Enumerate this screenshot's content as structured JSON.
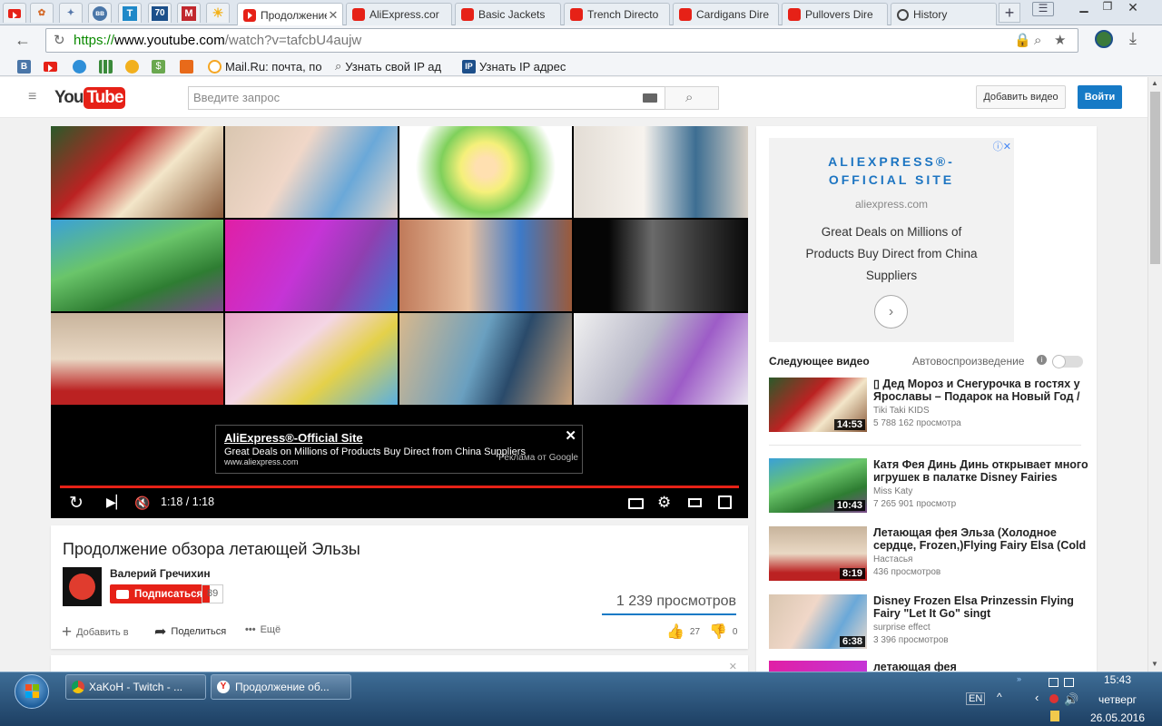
{
  "browser": {
    "tabs": [
      {
        "label": "Продолжение",
        "active": true
      },
      {
        "label": "AliExpress.cor"
      },
      {
        "label": "Basic Jackets"
      },
      {
        "label": "Trench Directo"
      },
      {
        "label": "Cardigans Dire"
      },
      {
        "label": "Pullovers Dire"
      },
      {
        "label": "History"
      }
    ],
    "pinned_labels": [
      "вв",
      "Т",
      "70",
      "М"
    ],
    "url": {
      "scheme": "https://",
      "host": "www.youtube.com",
      "path": "/watch?v=tafcbU4aujw"
    },
    "bookmarks": [
      {
        "label": "В"
      },
      {
        "label": "Mail.Ru: почта, по"
      },
      {
        "label": "Узнать свой IP ад"
      },
      {
        "label": "Узнать IP адрес"
      }
    ]
  },
  "youtube": {
    "logo": "You",
    "logo_tube": "Tube",
    "search_placeholder": "Введите запрос",
    "upload_label": "Добавить видео",
    "login_label": "Войти"
  },
  "player": {
    "ad": {
      "title": "AliExpress®-Official Site",
      "desc": "Great Deals on Millions of Products Buy Direct from China Suppliers",
      "url": "www.aliexpress.com",
      "by": "Реклама от Google"
    },
    "time": "1:18 / 1:18",
    "progress_fraction": 1.0
  },
  "video": {
    "title": "Продолжение обзора летающей Эльзы",
    "channel": "Валерий Гречихин",
    "subscribe_label": "Подписаться",
    "subscriber_count": "89",
    "views": "1 239 просмотров",
    "add_label": "Добавить в",
    "share_label": "Поделиться",
    "more_label": "Ещё",
    "likes": "27",
    "dislikes": "0"
  },
  "sidebar_ad": {
    "title_line1": "ALIEXPRESS®-",
    "title_line2": "OFFICIAL SITE",
    "domain": "aliexpress.com",
    "text_line1": "Great Deals on Millions of",
    "text_line2": "Products Buy Direct from China",
    "text_line3": "Suppliers"
  },
  "sidebar": {
    "up_next_label": "Следующее видео",
    "autoplay_label": "Автовоспроизведение",
    "items": [
      {
        "title": "▯ Дед Мороз и Снегурочка в гостях у Ярославы – Подарок на Новый Год /",
        "channel": "Tiki Taki KIDS",
        "views": "5 788 162 просмотра",
        "duration": "14:53"
      },
      {
        "title": "Катя Фея Динь Динь открывает много игрушек в палатке Disney Fairies Tinker",
        "channel": "Miss Katy",
        "views": "7 265 901 просмотр",
        "duration": "10:43"
      },
      {
        "title": "Летающая фея Эльза (Холодное сердце, Frozen,)Flying Fairy Elsa (Cold Heart,",
        "channel": "Настасья",
        "views": "436 просмотров",
        "duration": "8:19"
      },
      {
        "title": "Disney Frozen Elsa Prinzessin Flying Fairy \"Let It Go\" singt",
        "channel": "surprise effect",
        "views": "3 396 просмотров",
        "duration": "6:38"
      },
      {
        "title": "летающая фея",
        "channel": "",
        "views": "",
        "duration": ""
      }
    ]
  },
  "taskbar": {
    "buttons": [
      "XaKoH - Twitch - ...",
      "Продолжение об..."
    ],
    "lang": "EN",
    "time": "15:43",
    "day": "четверг",
    "date": "26.05.2016"
  }
}
